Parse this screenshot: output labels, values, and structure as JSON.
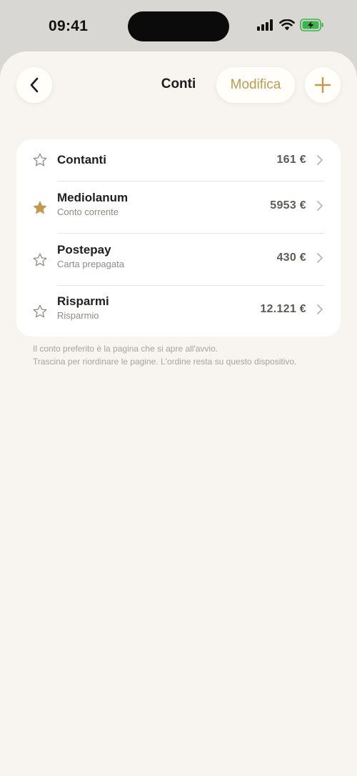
{
  "status_bar": {
    "time": "09:41"
  },
  "header": {
    "title": "Conti",
    "edit_label": "Modifica"
  },
  "accounts": [
    {
      "name": "Contanti",
      "subtitle": "",
      "amount": "161 €",
      "favorite": false
    },
    {
      "name": "Mediolanum",
      "subtitle": "Conto corrente",
      "amount": "5953 €",
      "favorite": true
    },
    {
      "name": "Postepay",
      "subtitle": "Carta prepagata",
      "amount": "430 €",
      "favorite": false
    },
    {
      "name": "Risparmi",
      "subtitle": "Risparmio",
      "amount": "12.121 €",
      "favorite": false
    }
  ],
  "footer": {
    "line1": "Il conto preferito è la pagina che si apre all'avvio.",
    "line2": "Trascina per riordinare le pagine. L'ordine resta su questo dispositivo."
  },
  "colors": {
    "accent": "#c29a4f",
    "background": "#f8f5f0",
    "battery": "#3bb54a"
  }
}
